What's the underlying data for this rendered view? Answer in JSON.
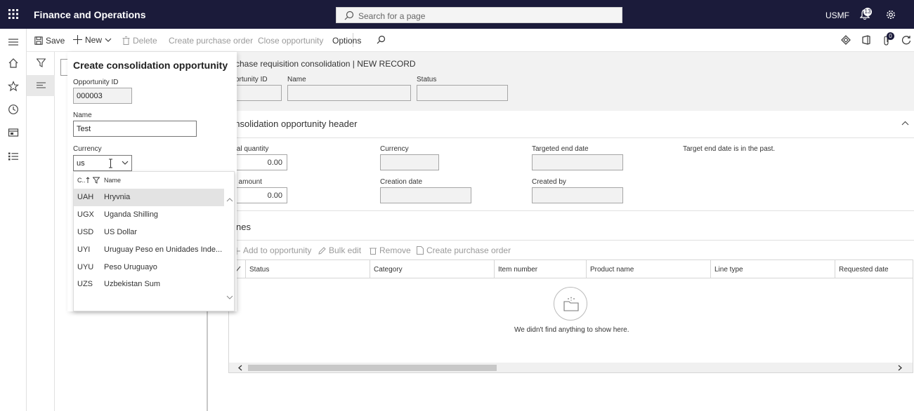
{
  "app": {
    "title": "Finance and Operations",
    "company": "USMF",
    "notification_count": "13"
  },
  "search": {
    "placeholder": "Search for a page"
  },
  "actionbar": {
    "save": "Save",
    "new": "New",
    "delete": "Delete",
    "create_po": "Create purchase order",
    "close_opportunity": "Close opportunity",
    "options": "Options",
    "favorites_count": "0"
  },
  "page": {
    "breadcrumb": "chase requisition consolidation  |  NEW RECORD",
    "top_fields": {
      "opportunity_id_label": "ortunity ID",
      "name_label": "Name",
      "status_label": "Status"
    },
    "header_section": {
      "title": "onsolidation opportunity header",
      "total_quantity_label": "tal quantity",
      "total_quantity_value": "0.00",
      "currency_label": "Currency",
      "targeted_end_label": "Targeted end date",
      "amount_label": "t amount",
      "amount_value": "0.00",
      "creation_date_label": "Creation date",
      "created_by_label": "Created by",
      "note": "Target end date is in the past."
    },
    "lines_section": {
      "title": "nes",
      "add": "Add to opportunity",
      "bulk_edit": "Bulk edit",
      "remove": "Remove",
      "create_po": "Create purchase order",
      "columns": [
        "Status",
        "Category",
        "Item number",
        "Product name",
        "Line type",
        "Requested date"
      ],
      "empty_text": "We didn't find anything to show here."
    }
  },
  "dialog": {
    "title": "Create consolidation opportunity",
    "opportunity_id_label": "Opportunity ID",
    "opportunity_id_value": "000003",
    "name_label": "Name",
    "name_value": "Test",
    "currency_label": "Currency",
    "currency_value": "us"
  },
  "currency_dropdown": {
    "col_code": "C..",
    "col_name": "Name",
    "rows": [
      {
        "code": "UAH",
        "name": "Hryvnia"
      },
      {
        "code": "UGX",
        "name": "Uganda Shilling"
      },
      {
        "code": "USD",
        "name": "US Dollar"
      },
      {
        "code": "UYI",
        "name": "Uruguay Peso en Unidades Inde..."
      },
      {
        "code": "UYU",
        "name": "Peso Uruguayo"
      },
      {
        "code": "UZS",
        "name": "Uzbekistan Sum"
      }
    ]
  },
  "colors": {
    "topbar": "#1b1b3a",
    "selected_row": "#e3e3e3"
  }
}
